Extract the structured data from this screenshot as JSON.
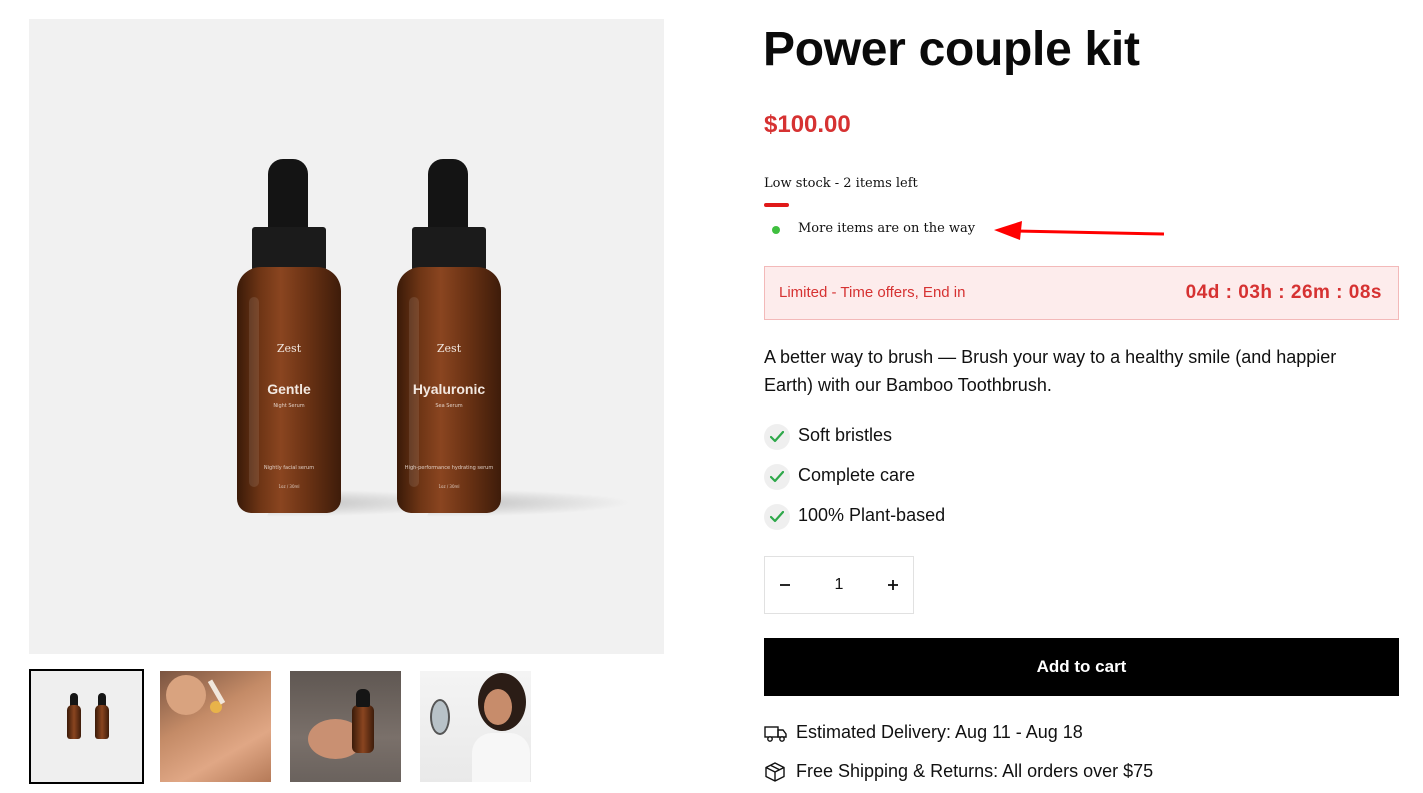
{
  "product": {
    "title": "Power couple kit",
    "price": "$100.00",
    "stock_status": "Low stock - 2 items left",
    "restock_note": "More items are on the way",
    "offer": {
      "label": "Limited - Time offers, End in",
      "countdown": "04d : 03h : 26m : 08s"
    },
    "description": "A better way to brush — Brush your way to a healthy smile (and happier Earth) with our Bamboo Toothbrush.",
    "features": [
      "Soft bristles",
      "Complete care",
      "100% Plant-based"
    ],
    "quantity": "1",
    "add_to_cart_label": "Add to cart",
    "delivery": "Estimated Delivery: Aug 11 - Aug 18",
    "shipping": "Free Shipping & Returns: All orders over $75"
  },
  "gallery": {
    "bottles": [
      {
        "brand": "Zest",
        "name": "Gentle",
        "sub": "Night Serum",
        "desc": "Nightly facial serum",
        "size": "1oz / 30ml"
      },
      {
        "brand": "Zest",
        "name": "Hyaluronic",
        "sub": "Sea Serum",
        "desc": "High-performance hydrating serum",
        "size": "1oz / 30ml"
      }
    ],
    "thumbnails": [
      "product-bottles",
      "dropper-on-skin",
      "hands-holding-bottle",
      "woman-applying-serum"
    ],
    "active_thumbnail": 0
  },
  "colors": {
    "price": "#d63232",
    "stock_bar": "#e01919",
    "in_transit_dot": "#3fbf3f",
    "offer_background": "#fdecec",
    "offer_border": "#f3b9b9",
    "button": "#000000",
    "check": "#2ea84a",
    "annotation_arrow": "#ff0000"
  },
  "icons": {
    "feature": "check-icon",
    "delivery": "truck-icon",
    "shipping": "box-icon",
    "quantity_decrease": "minus-icon",
    "quantity_increase": "plus-icon"
  }
}
